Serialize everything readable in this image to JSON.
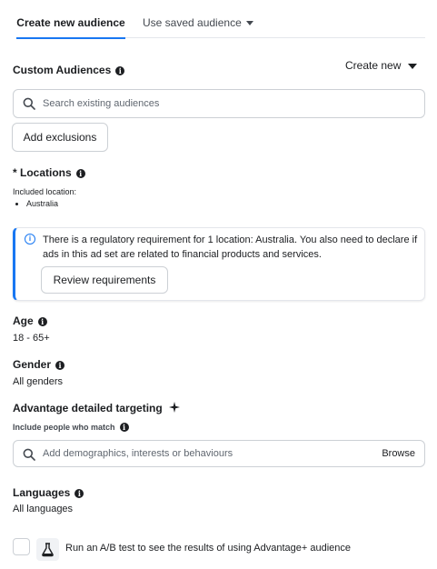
{
  "tabs": {
    "create_new_audience": "Create new audience",
    "use_saved_audience": "Use saved audience"
  },
  "custom_audiences": {
    "title": "Custom Audiences",
    "create_new": "Create new",
    "search_placeholder": "Search existing audiences",
    "add_exclusions": "Add exclusions"
  },
  "locations": {
    "title": "* Locations",
    "included_label": "Included location:",
    "items": [
      "Australia"
    ]
  },
  "notice": {
    "text": "There is a regulatory requirement for 1 location: Australia. You also need to declare if ads in this ad set are related to financial products and services.",
    "button": "Review requirements"
  },
  "age": {
    "title": "Age",
    "value": "18 - 65+"
  },
  "gender": {
    "title": "Gender",
    "value": "All genders"
  },
  "detailed_targeting": {
    "title": "Advantage detailed targeting",
    "sublabel": "Include people who match",
    "search_placeholder": "Add demographics, interests or behaviours",
    "browse": "Browse"
  },
  "languages": {
    "title": "Languages",
    "value": "All languages"
  },
  "ab_test": {
    "label": "Run an A/B test to see the results of using Advantage+ audience"
  },
  "colors": {
    "accent": "#1877f2",
    "text": "#1c1e21",
    "border": "#ccd0d5"
  }
}
